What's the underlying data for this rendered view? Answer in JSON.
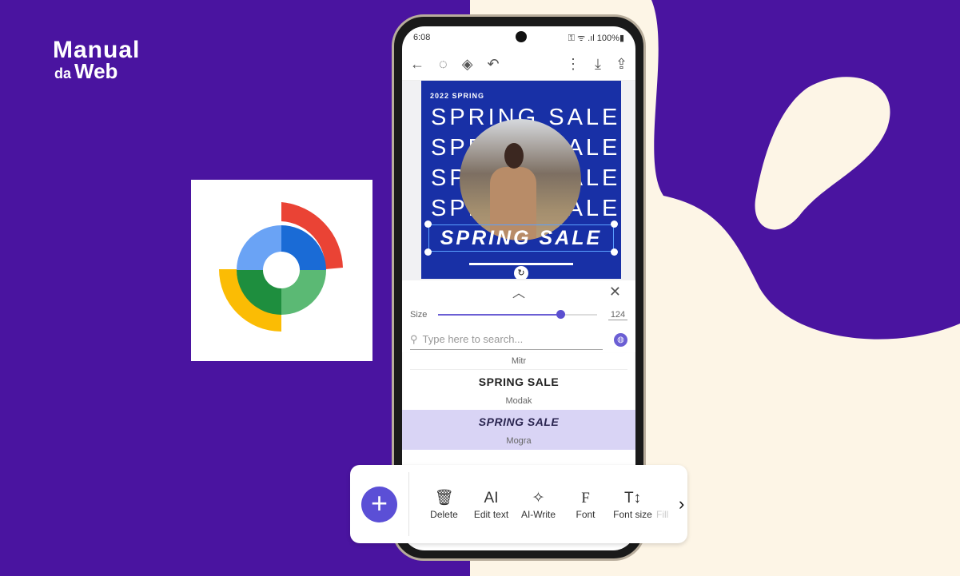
{
  "brand": {
    "line1": "Manual",
    "line2a": "da",
    "line2b": "Web"
  },
  "colors": {
    "background": "#4a14a0",
    "cream": "#fdf5e6",
    "accent": "#5b4fd6",
    "poster": "#1830a6"
  },
  "status": {
    "time": "6:08",
    "icons": "⚿ ᯤ .ıl",
    "battery": "100%"
  },
  "app_toolbar": {
    "icons": [
      "back-arrow-icon",
      "play-circle-icon",
      "layers-icon",
      "undo-icon",
      "more-vert-icon",
      "download-icon",
      "share-icon"
    ]
  },
  "poster": {
    "year": "2022 SPRING",
    "rows": [
      "SPRING SALE",
      "SPRING SALE",
      "SPRING SALE",
      "SPRING SALE"
    ],
    "selected_text": "SPRING SALE"
  },
  "panel": {
    "size_label": "Size",
    "size_value": "124",
    "size_fraction": 0.77,
    "search_placeholder": "Type here to search..."
  },
  "fonts": [
    {
      "name": "Mitr"
    },
    {
      "preview": "SPRING SALE",
      "name": "Modak"
    },
    {
      "preview": "SPRING SALE",
      "name": "Mogra",
      "selected": true
    }
  ],
  "tools": [
    {
      "label": "Delete",
      "icon": "🗑"
    },
    {
      "label": "Edit text",
      "icon": "AI"
    },
    {
      "label": "AI-Write",
      "icon": "✧"
    },
    {
      "label": "Font",
      "icon": "F"
    },
    {
      "label": "Font size",
      "icon": "T↕"
    },
    {
      "label": "Fill"
    }
  ]
}
